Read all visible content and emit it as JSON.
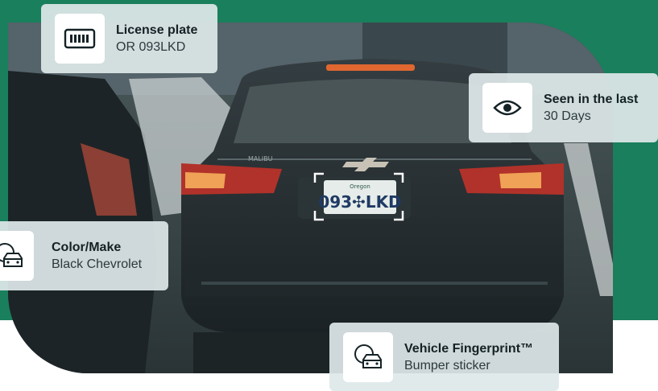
{
  "cards": {
    "plate": {
      "title": "License plate",
      "value": "OR 093LKD",
      "icon": "license-plate-icon"
    },
    "seen": {
      "title": "Seen in the last",
      "value": "30 Days",
      "icon": "eye-icon"
    },
    "color": {
      "title": "Color/Make",
      "value": "Black Chevrolet",
      "icon": "car-icon"
    },
    "finger": {
      "title": "Vehicle Fingerprint™",
      "value": "Bumper sticker",
      "icon": "car-fingerprint-icon"
    }
  },
  "photo": {
    "plate_state": "Oregon",
    "plate_number": "093✣LKD",
    "model_badge": "MALIBU"
  },
  "colors": {
    "accent_green": "#1a7f5c",
    "card_bg": "#dee8e9",
    "text_dark": "#142226"
  }
}
